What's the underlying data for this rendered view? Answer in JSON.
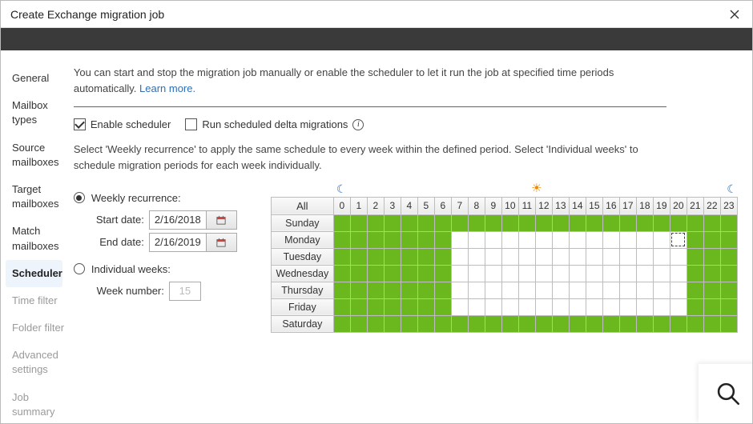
{
  "window": {
    "title": "Create Exchange migration job"
  },
  "sidebar": {
    "items": [
      {
        "label": "General",
        "dim": false,
        "active": false
      },
      {
        "label": "Mailbox types",
        "dim": false,
        "active": false
      },
      {
        "label": "Source mailboxes",
        "dim": false,
        "active": false
      },
      {
        "label": "Target mailboxes",
        "dim": false,
        "active": false
      },
      {
        "label": "Match mailboxes",
        "dim": false,
        "active": false
      },
      {
        "label": "Scheduler",
        "dim": false,
        "active": true
      },
      {
        "label": "Time filter",
        "dim": true,
        "active": false
      },
      {
        "label": "Folder filter",
        "dim": true,
        "active": false
      },
      {
        "label": "Advanced settings",
        "dim": true,
        "active": false
      },
      {
        "label": "Job summary",
        "dim": true,
        "active": false
      }
    ]
  },
  "intro": {
    "text": "You can start and stop the migration job manually or enable the scheduler to let it run the job at specified time periods automatically. ",
    "learn_more": "Learn more."
  },
  "options": {
    "enable_scheduler_label": "Enable scheduler",
    "enable_scheduler_checked": true,
    "delta_label": "Run scheduled delta migrations",
    "delta_checked": false
  },
  "desc": "Select 'Weekly recurrence' to apply the same schedule to every week within the defined period. Select 'Individual weeks' to schedule migration periods for each week individually.",
  "recurrence": {
    "weekly_label": "Weekly recurrence:",
    "weekly_selected": true,
    "start_label": "Start date:",
    "start_value": "2/16/2018",
    "end_label": "End date:",
    "end_value": "2/16/2019",
    "individual_label": "Individual weeks:",
    "individual_selected": false,
    "weeknum_label": "Week number:",
    "weeknum_value": "15"
  },
  "schedule": {
    "all_label": "All",
    "hours": [
      "0",
      "1",
      "2",
      "3",
      "4",
      "5",
      "6",
      "7",
      "8",
      "9",
      "10",
      "11",
      "12",
      "13",
      "14",
      "15",
      "16",
      "17",
      "18",
      "19",
      "20",
      "21",
      "22",
      "23"
    ],
    "days": [
      "Sunday",
      "Monday",
      "Tuesday",
      "Wednesday",
      "Thursday",
      "Friday",
      "Saturday"
    ],
    "grid": [
      [
        1,
        1,
        1,
        1,
        1,
        1,
        1,
        1,
        1,
        1,
        1,
        1,
        1,
        1,
        1,
        1,
        1,
        1,
        1,
        1,
        1,
        1,
        1,
        1
      ],
      [
        1,
        1,
        1,
        1,
        1,
        1,
        1,
        0,
        0,
        0,
        0,
        0,
        0,
        0,
        0,
        0,
        0,
        0,
        0,
        0,
        0,
        1,
        1,
        1
      ],
      [
        1,
        1,
        1,
        1,
        1,
        1,
        1,
        0,
        0,
        0,
        0,
        0,
        0,
        0,
        0,
        0,
        0,
        0,
        0,
        0,
        0,
        1,
        1,
        1
      ],
      [
        1,
        1,
        1,
        1,
        1,
        1,
        1,
        0,
        0,
        0,
        0,
        0,
        0,
        0,
        0,
        0,
        0,
        0,
        0,
        0,
        0,
        1,
        1,
        1
      ],
      [
        1,
        1,
        1,
        1,
        1,
        1,
        1,
        0,
        0,
        0,
        0,
        0,
        0,
        0,
        0,
        0,
        0,
        0,
        0,
        0,
        0,
        1,
        1,
        1
      ],
      [
        1,
        1,
        1,
        1,
        1,
        1,
        1,
        0,
        0,
        0,
        0,
        0,
        0,
        0,
        0,
        0,
        0,
        0,
        0,
        0,
        0,
        1,
        1,
        1
      ],
      [
        1,
        1,
        1,
        1,
        1,
        1,
        1,
        1,
        1,
        1,
        1,
        1,
        1,
        1,
        1,
        1,
        1,
        1,
        1,
        1,
        1,
        1,
        1,
        1
      ]
    ],
    "focus_cell": {
      "day": 1,
      "hour": 20
    }
  },
  "colors": {
    "accent": "#2f6fb2",
    "schedule_on": "#6ab81e"
  }
}
